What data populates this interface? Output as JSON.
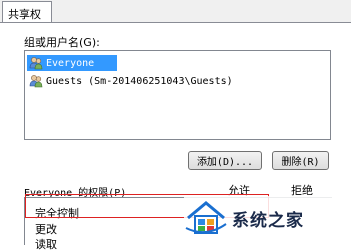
{
  "tab": {
    "label": "共享权限"
  },
  "groups": {
    "label": "组或用户名(G):",
    "users": [
      {
        "name": "Everyone",
        "selected": true,
        "icon": "users-group-icon"
      },
      {
        "name": "Guests (Sm-201406251043\\Guests)",
        "selected": false,
        "icon": "users-group-icon"
      }
    ]
  },
  "buttons": {
    "add": "添加(D)...",
    "remove": "删除(R)"
  },
  "permissions": {
    "label": "Everyone 的权限(P)",
    "allow_header": "允许",
    "deny_header": "拒绝",
    "rows": [
      "完全控制",
      "更改",
      "读取"
    ]
  },
  "watermark": {
    "text": "系统之家"
  },
  "colors": {
    "selection": "#3399ff",
    "highlight_box": "#dd2222"
  }
}
